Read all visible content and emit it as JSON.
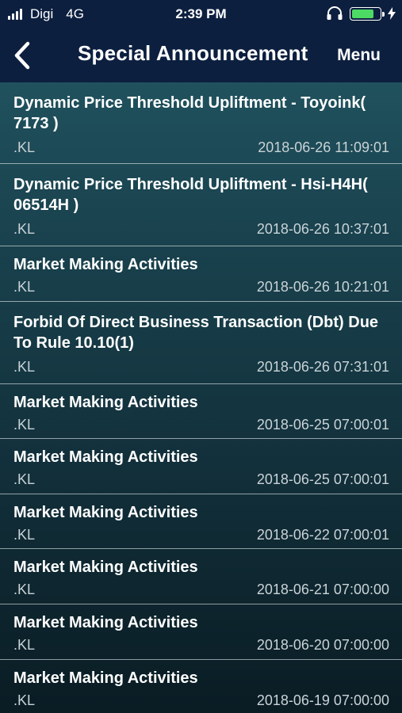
{
  "status_bar": {
    "carrier": "Digi",
    "network": "4G",
    "time": "2:39 PM",
    "battery_level": 0.8
  },
  "nav": {
    "title": "Special Announcement",
    "menu_label": "Menu"
  },
  "announcements": [
    {
      "title": "Dynamic Price Threshold Upliftment - Toyoink( 7173 )",
      "exchange": ".KL",
      "datetime": "2018-06-26 11:09:01"
    },
    {
      "title": "Dynamic Price Threshold Upliftment - Hsi-H4H( 06514H )",
      "exchange": ".KL",
      "datetime": "2018-06-26 10:37:01"
    },
    {
      "title": "Market Making Activities",
      "exchange": ".KL",
      "datetime": "2018-06-26 10:21:01"
    },
    {
      "title": "Forbid Of Direct Business Transaction (Dbt) Due To Rule 10.10(1)",
      "exchange": ".KL",
      "datetime": "2018-06-26 07:31:01"
    },
    {
      "title": "Market Making Activities",
      "exchange": ".KL",
      "datetime": "2018-06-25 07:00:01"
    },
    {
      "title": "Market Making Activities",
      "exchange": ".KL",
      "datetime": "2018-06-25 07:00:01"
    },
    {
      "title": "Market Making Activities",
      "exchange": ".KL",
      "datetime": "2018-06-22 07:00:01"
    },
    {
      "title": "Market Making Activities",
      "exchange": ".KL",
      "datetime": "2018-06-21 07:00:00"
    },
    {
      "title": "Market Making Activities",
      "exchange": ".KL",
      "datetime": "2018-06-20 07:00:00"
    },
    {
      "title": "Market Making Activities",
      "exchange": ".KL",
      "datetime": "2018-06-19 07:00:00"
    }
  ]
}
